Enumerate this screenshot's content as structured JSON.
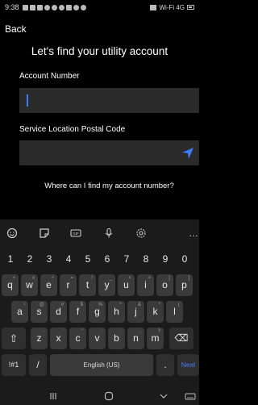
{
  "status_bar": {
    "time": "9:38",
    "network": "Wi-Fi 4G"
  },
  "nav": {
    "back_label": "Back"
  },
  "title": "Let's find your utility account",
  "form": {
    "account_number": {
      "label": "Account Number",
      "value": ""
    },
    "postal_code": {
      "label": "Service Location Postal Code",
      "value": ""
    }
  },
  "help_link": "Where can I find my account number?",
  "keyboard": {
    "toolbar_icons": [
      "emoji-icon",
      "sticker-icon",
      "gif-icon",
      "microphone-icon",
      "settings-icon",
      "more-icon"
    ],
    "gif_label": "GIF",
    "number_row": [
      "1",
      "2",
      "3",
      "4",
      "5",
      "6",
      "7",
      "8",
      "9",
      "0"
    ],
    "row1": [
      {
        "key": "q",
        "sub": "+"
      },
      {
        "key": "w",
        "sub": "x"
      },
      {
        "key": "e",
        "sub": "÷"
      },
      {
        "key": "r",
        "sub": "="
      },
      {
        "key": "t",
        "sub": "/"
      },
      {
        "key": "y",
        "sub": "_"
      },
      {
        "key": "u",
        "sub": "<"
      },
      {
        "key": "i",
        "sub": ">"
      },
      {
        "key": "o",
        "sub": "["
      },
      {
        "key": "p",
        "sub": "]"
      }
    ],
    "row2": [
      {
        "key": "a",
        "sub": "!"
      },
      {
        "key": "s",
        "sub": "@"
      },
      {
        "key": "d",
        "sub": "#"
      },
      {
        "key": "f",
        "sub": "$"
      },
      {
        "key": "g",
        "sub": "%"
      },
      {
        "key": "h",
        "sub": "^"
      },
      {
        "key": "j",
        "sub": "&"
      },
      {
        "key": "k",
        "sub": "*"
      },
      {
        "key": "l",
        "sub": "("
      }
    ],
    "row3": [
      {
        "key": "z",
        "sub": "-"
      },
      {
        "key": "x",
        "sub": "'"
      },
      {
        "key": "c",
        "sub": "\""
      },
      {
        "key": "v",
        "sub": ":"
      },
      {
        "key": "b",
        "sub": ";"
      },
      {
        "key": "n",
        "sub": ","
      },
      {
        "key": "m",
        "sub": "?"
      }
    ],
    "symbols_label": "!#1",
    "slash_label": "/",
    "space_label": "English (US)",
    "period_label": ".",
    "next_label": "Next"
  },
  "colors": {
    "accent": "#3d7bff",
    "input_bg": "#2b2b2b",
    "background": "#000000"
  }
}
